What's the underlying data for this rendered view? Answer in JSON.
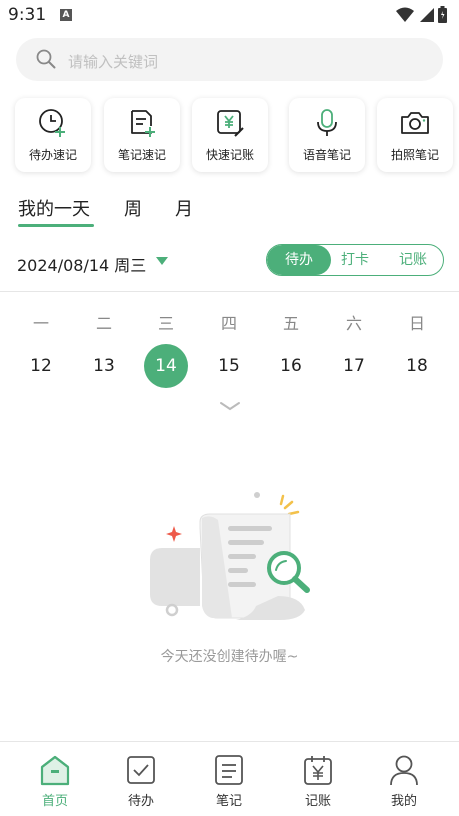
{
  "status_bar": {
    "time": "9:31",
    "badge": "A"
  },
  "search": {
    "placeholder": "请输入关键词"
  },
  "quick_actions": [
    {
      "label": "待办速记",
      "icon": "clock-add-icon"
    },
    {
      "label": "笔记速记",
      "icon": "note-add-icon"
    },
    {
      "label": "快速记账",
      "icon": "yuan-edit-icon"
    },
    {
      "label": "语音笔记",
      "icon": "microphone-icon"
    },
    {
      "label": "拍照笔记",
      "icon": "camera-icon"
    }
  ],
  "view_tabs": [
    {
      "label": "我的一天",
      "active": true
    },
    {
      "label": "周",
      "active": false
    },
    {
      "label": "月",
      "active": false
    }
  ],
  "date_label": "2024/08/14 周三",
  "segments": [
    {
      "label": "待办",
      "active": true
    },
    {
      "label": "打卡",
      "active": false
    },
    {
      "label": "记账",
      "active": false
    }
  ],
  "weekdays": [
    "一",
    "二",
    "三",
    "四",
    "五",
    "六",
    "日"
  ],
  "days": [
    "12",
    "13",
    "14",
    "15",
    "16",
    "17",
    "18"
  ],
  "selected_day_index": 2,
  "empty_message": "今天还没创建待办喔~",
  "bottom_nav": [
    {
      "label": "首页",
      "icon": "home-icon",
      "active": true
    },
    {
      "label": "待办",
      "icon": "checkbox-icon",
      "active": false
    },
    {
      "label": "笔记",
      "icon": "document-icon",
      "active": false
    },
    {
      "label": "记账",
      "icon": "calendar-yuan-icon",
      "active": false
    },
    {
      "label": "我的",
      "icon": "user-icon",
      "active": false
    }
  ],
  "colors": {
    "accent": "#4caf7a",
    "search_bg": "#f3f3f3",
    "muted": "#9a9a9a"
  }
}
